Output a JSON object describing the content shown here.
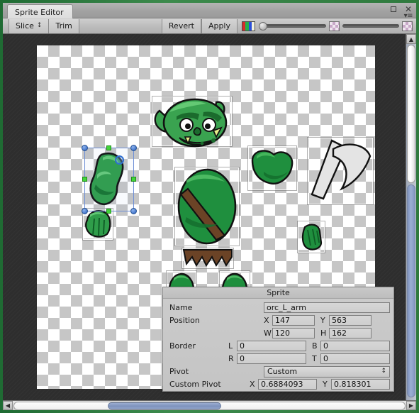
{
  "window": {
    "tab_label": "Sprite Editor",
    "maximize_icon": "maximize-icon",
    "close_icon": "close-icon",
    "menu_icon": "hamburger-menu-icon"
  },
  "toolbar": {
    "slice_label": "Slice",
    "slice_stepper": "↕",
    "trim_label": "Trim",
    "revert_label": "Revert",
    "apply_label": "Apply",
    "rgb_icon": "rgb-channel-icon",
    "alpha_slider_name": "alpha-slider",
    "zoom_slider_name": "zoom-slider",
    "checker_icon_left": "checkerboard-icon",
    "checker_icon_right": "checkerboard-icon"
  },
  "panel": {
    "title": "Sprite",
    "name_label": "Name",
    "name_value": "orc_L_arm",
    "position_label": "Position",
    "position": {
      "x_tag": "X",
      "x": "147",
      "y_tag": "Y",
      "y": "563",
      "w_tag": "W",
      "w": "120",
      "h_tag": "H",
      "h": "162"
    },
    "border_label": "Border",
    "border": {
      "l_tag": "L",
      "l": "0",
      "b_tag": "B",
      "b": "0",
      "r_tag": "R",
      "r": "0",
      "t_tag": "T",
      "t": "0"
    },
    "pivot_label": "Pivot",
    "pivot_value": "Custom",
    "pivot_stepper": "↕",
    "custom_pivot_label": "Custom Pivot",
    "custom_pivot": {
      "x_tag": "X",
      "x": "0.6884093",
      "y_tag": "Y",
      "y": "0.818301"
    }
  },
  "scrollbars": {
    "v_up_arrow": "▲",
    "h_left_arrow": "◀",
    "h_right_arrow": "▶"
  },
  "colors": {
    "window_border": "#2f7a3e",
    "canvas_bg": "#2e2e2e",
    "selection": "#6d8fd6",
    "handle_edge": "#43d43a",
    "orc_green": "#2f9d4a",
    "strap_brown": "#6b4326",
    "axe_grey": "#e4e4e4"
  }
}
